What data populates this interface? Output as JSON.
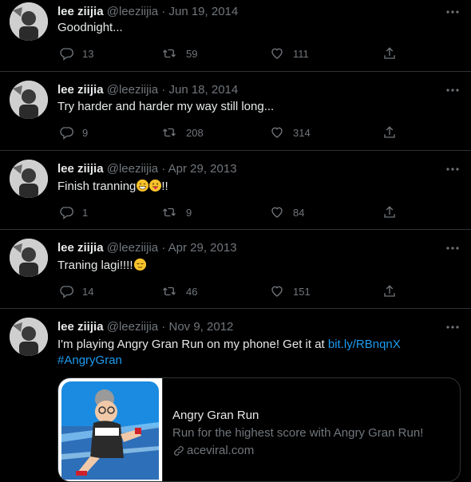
{
  "tweets": [
    {
      "name": "lee ziijia",
      "handle": "@leeziijia",
      "sep": "·",
      "date": "Jun 19, 2014",
      "text": "Goodnight...",
      "replies": "13",
      "retweets": "59",
      "likes": "111"
    },
    {
      "name": "lee ziijia",
      "handle": "@leeziijia",
      "sep": "·",
      "date": "Jun 18, 2014",
      "text": "Try harder and harder my way still long...",
      "replies": "9",
      "retweets": "208",
      "likes": "314"
    },
    {
      "name": "lee ziijia",
      "handle": "@leeziijia",
      "sep": "·",
      "date": "Apr 29, 2013",
      "text": "Finish tranning",
      "text_after": "!!",
      "replies": "1",
      "retweets": "9",
      "likes": "84"
    },
    {
      "name": "lee ziijia",
      "handle": "@leeziijia",
      "sep": "·",
      "date": "Apr 29, 2013",
      "text": "Traning lagi!!!!",
      "replies": "14",
      "retweets": "46",
      "likes": "151"
    },
    {
      "name": "lee ziijia",
      "handle": "@leeziijia",
      "sep": "·",
      "date": "Nov 9, 2012",
      "text": "I'm playing Angry Gran Run on my phone! Get it at ",
      "link": "bit.ly/RBnqnX",
      "hashtag": "#AngryGran",
      "card": {
        "title": "Angry Gran Run",
        "description": "Run for the highest score with Angry Gran Run!",
        "domain": "aceviral.com"
      }
    }
  ],
  "icons": {
    "reply": "reply-icon",
    "retweet": "retweet-icon",
    "like": "heart-icon",
    "share": "share-icon",
    "more": "more-icon",
    "link": "link-icon"
  },
  "colors": {
    "background": "#000000",
    "text": "#e7e9ea",
    "muted": "#71767b",
    "link": "#1d9bf0",
    "divider": "#2f3336"
  }
}
